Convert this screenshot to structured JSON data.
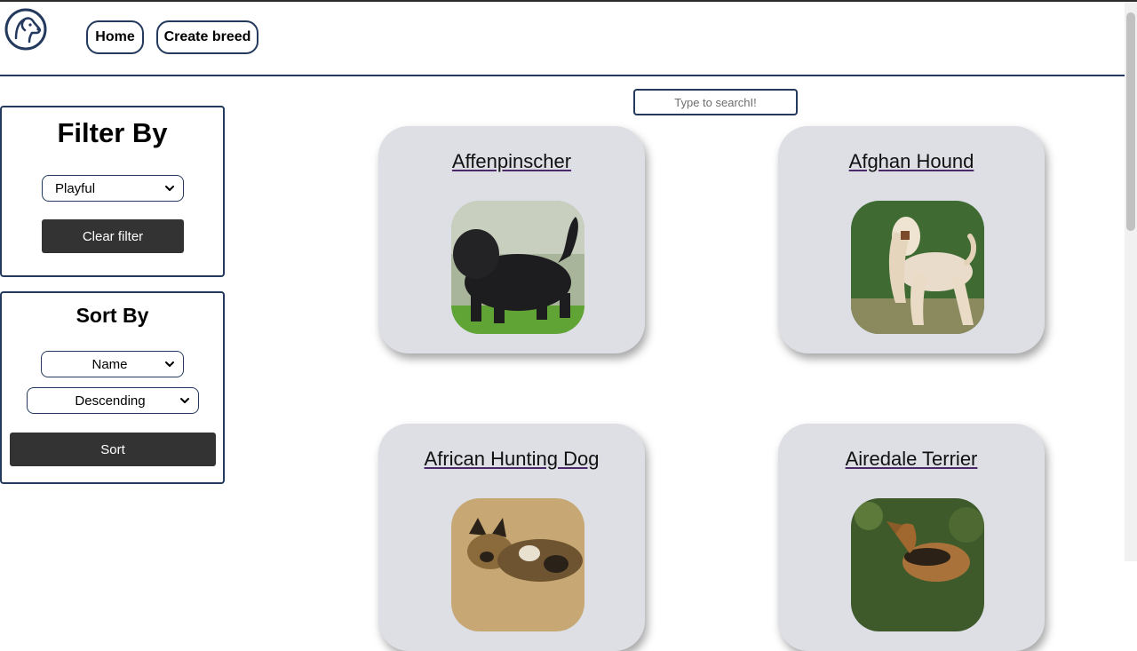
{
  "nav": {
    "logo_icon": "dog-head-logo-icon",
    "home_label": "Home",
    "create_label": "Create breed"
  },
  "search": {
    "placeholder": "Type to searchI!"
  },
  "filter": {
    "title": "Filter By",
    "selected_temperament": "Playful",
    "clear_label": "Clear filter"
  },
  "sort": {
    "title": "Sort By",
    "selected_field": "Name",
    "selected_order": "Descending",
    "sort_label": "Sort"
  },
  "breeds": [
    {
      "name": "Affenpinscher"
    },
    {
      "name": "Afghan Hound"
    },
    {
      "name": "African Hunting Dog"
    },
    {
      "name": "Airedale Terrier"
    }
  ],
  "colors": {
    "accent": "#23395d",
    "card_bg": "#dddfe5",
    "button_dark": "#333333"
  }
}
